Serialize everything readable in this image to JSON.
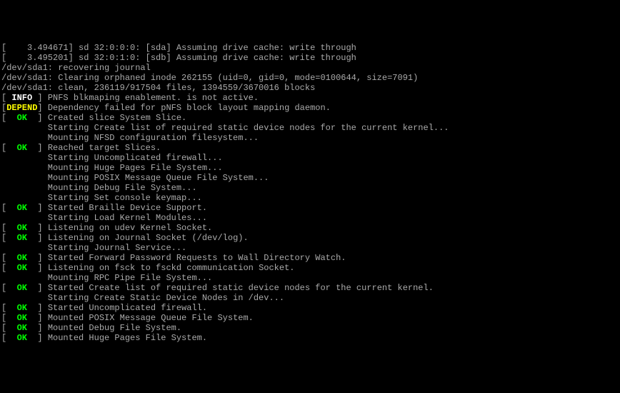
{
  "lines": [
    {
      "segments": [
        {
          "cls": "gray",
          "t": "[    3.494671] sd 32:0:0:0: [sda] Assuming drive cache: write through"
        }
      ]
    },
    {
      "segments": [
        {
          "cls": "gray",
          "t": "[    3.495201] sd 32:0:1:0: [sdb] Assuming drive cache: write through"
        }
      ]
    },
    {
      "segments": [
        {
          "cls": "gray",
          "t": "/dev/sda1: recovering journal"
        }
      ]
    },
    {
      "segments": [
        {
          "cls": "gray",
          "t": "/dev/sda1: Clearing orphaned inode 262155 (uid=0, gid=0, mode=0100644, size=7091)"
        }
      ]
    },
    {
      "segments": [
        {
          "cls": "gray",
          "t": "/dev/sda1: clean, 236119/917504 files, 1394559/3670016 blocks"
        }
      ]
    },
    {
      "segments": [
        {
          "cls": "gray",
          "t": "[ "
        },
        {
          "cls": "white",
          "t": "INFO"
        },
        {
          "cls": "gray",
          "t": " ] PNFS blkmaping enablement. is not active."
        }
      ]
    },
    {
      "segments": [
        {
          "cls": "gray",
          "t": "["
        },
        {
          "cls": "yellow",
          "t": "DEPEND"
        },
        {
          "cls": "gray",
          "t": "] Dependency failed for pNFS block layout mapping daemon."
        }
      ]
    },
    {
      "segments": [
        {
          "cls": "gray",
          "t": "[  "
        },
        {
          "cls": "green",
          "t": "OK"
        },
        {
          "cls": "gray",
          "t": "  ] Created slice System Slice."
        }
      ]
    },
    {
      "segments": [
        {
          "cls": "gray",
          "t": "         Starting Create list of required static device nodes for the current kernel..."
        }
      ]
    },
    {
      "segments": [
        {
          "cls": "gray",
          "t": "         Mounting NFSD configuration filesystem..."
        }
      ]
    },
    {
      "segments": [
        {
          "cls": "gray",
          "t": "[  "
        },
        {
          "cls": "green",
          "t": "OK"
        },
        {
          "cls": "gray",
          "t": "  ] Reached target Slices."
        }
      ]
    },
    {
      "segments": [
        {
          "cls": "gray",
          "t": "         Starting Uncomplicated firewall..."
        }
      ]
    },
    {
      "segments": [
        {
          "cls": "gray",
          "t": "         Mounting Huge Pages File System..."
        }
      ]
    },
    {
      "segments": [
        {
          "cls": "gray",
          "t": "         Mounting POSIX Message Queue File System..."
        }
      ]
    },
    {
      "segments": [
        {
          "cls": "gray",
          "t": "         Mounting Debug File System..."
        }
      ]
    },
    {
      "segments": [
        {
          "cls": "gray",
          "t": "         Starting Set console keymap..."
        }
      ]
    },
    {
      "segments": [
        {
          "cls": "gray",
          "t": "[  "
        },
        {
          "cls": "green",
          "t": "OK"
        },
        {
          "cls": "gray",
          "t": "  ] Started Braille Device Support."
        }
      ]
    },
    {
      "segments": [
        {
          "cls": "gray",
          "t": "         Starting Load Kernel Modules..."
        }
      ]
    },
    {
      "segments": [
        {
          "cls": "gray",
          "t": "[  "
        },
        {
          "cls": "green",
          "t": "OK"
        },
        {
          "cls": "gray",
          "t": "  ] Listening on udev Kernel Socket."
        }
      ]
    },
    {
      "segments": [
        {
          "cls": "gray",
          "t": "[  "
        },
        {
          "cls": "green",
          "t": "OK"
        },
        {
          "cls": "gray",
          "t": "  ] Listening on Journal Socket (/dev/log)."
        }
      ]
    },
    {
      "segments": [
        {
          "cls": "gray",
          "t": "         Starting Journal Service..."
        }
      ]
    },
    {
      "segments": [
        {
          "cls": "gray",
          "t": "[  "
        },
        {
          "cls": "green",
          "t": "OK"
        },
        {
          "cls": "gray",
          "t": "  ] Started Forward Password Requests to Wall Directory Watch."
        }
      ]
    },
    {
      "segments": [
        {
          "cls": "gray",
          "t": "[  "
        },
        {
          "cls": "green",
          "t": "OK"
        },
        {
          "cls": "gray",
          "t": "  ] Listening on fsck to fsckd communication Socket."
        }
      ]
    },
    {
      "segments": [
        {
          "cls": "gray",
          "t": "         Mounting RPC Pipe File System..."
        }
      ]
    },
    {
      "segments": [
        {
          "cls": "gray",
          "t": "[  "
        },
        {
          "cls": "green",
          "t": "OK"
        },
        {
          "cls": "gray",
          "t": "  ] Started Create list of required static device nodes for the current kernel."
        }
      ]
    },
    {
      "segments": [
        {
          "cls": "gray",
          "t": "         Starting Create Static Device Nodes in /dev..."
        }
      ]
    },
    {
      "segments": [
        {
          "cls": "gray",
          "t": "[  "
        },
        {
          "cls": "green",
          "t": "OK"
        },
        {
          "cls": "gray",
          "t": "  ] Started Uncomplicated firewall."
        }
      ]
    },
    {
      "segments": [
        {
          "cls": "gray",
          "t": "[  "
        },
        {
          "cls": "green",
          "t": "OK"
        },
        {
          "cls": "gray",
          "t": "  ] Mounted POSIX Message Queue File System."
        }
      ]
    },
    {
      "segments": [
        {
          "cls": "gray",
          "t": "[  "
        },
        {
          "cls": "green",
          "t": "OK"
        },
        {
          "cls": "gray",
          "t": "  ] Mounted Debug File System."
        }
      ]
    },
    {
      "segments": [
        {
          "cls": "gray",
          "t": "[  "
        },
        {
          "cls": "green",
          "t": "OK"
        },
        {
          "cls": "gray",
          "t": "  ] Mounted Huge Pages File System."
        }
      ]
    }
  ]
}
